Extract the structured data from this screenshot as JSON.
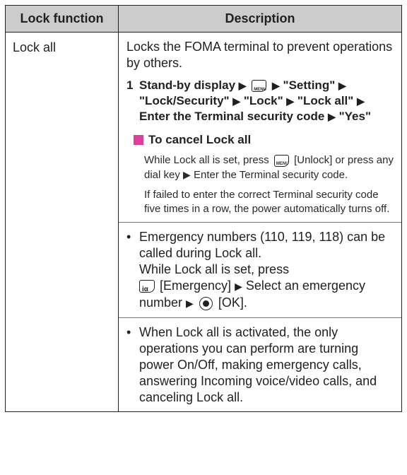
{
  "table": {
    "headers": {
      "function": "Lock function",
      "description": "Description"
    },
    "row": {
      "function": "Lock all",
      "intro": "Locks the FOMA terminal to prevent operations by others.",
      "step": {
        "number": "1",
        "p1": "Stand-by display",
        "p2": "\"Setting\"",
        "p3": "\"Lock/Security\"",
        "p4": "\"Lock\"",
        "p5": "\"Lock all\"",
        "p6": "Enter the Terminal security code",
        "p7": "\"Yes\""
      },
      "cancel": {
        "heading": "To cancel Lock all",
        "line1_a": "While Lock all is set, press",
        "line1_b": "[Unlock] or press any dial key",
        "line1_c": "Enter the Terminal security code.",
        "line2": "If failed to enter the correct Terminal security code five times in a row, the power automatically turns off."
      },
      "note1": {
        "a": "Emergency numbers (110, 119, 118) can be called during Lock all.",
        "b": "While Lock all is set, press",
        "c": "[Emergency]",
        "d": "Select an emergency number",
        "e": "[OK]."
      },
      "note2": "When Lock all is activated, the only operations you can perform are turning power On/Off, making emergency calls, answering Incoming voice/video calls, and canceling Lock all."
    }
  },
  "icons": {
    "arrow": "▶",
    "bullet": "•",
    "menu_key_label": "MENU",
    "i_key_label": "iα"
  },
  "colors": {
    "accent": "#e0409b",
    "header_bg": "#cccccc"
  }
}
